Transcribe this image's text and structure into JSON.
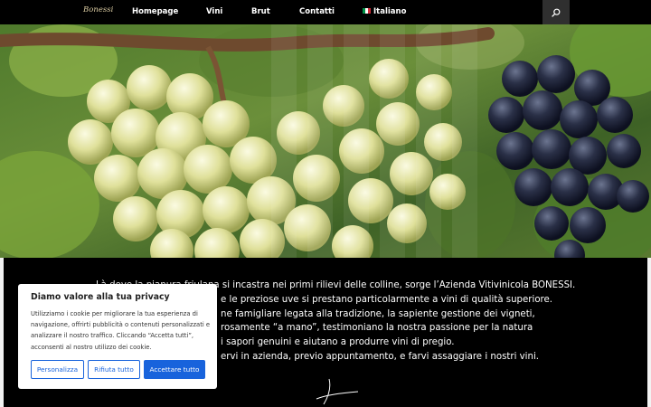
{
  "header": {
    "logo_text": "Bonessi",
    "menu": [
      "Homepage",
      "Vini",
      "Brut",
      "Contatti"
    ],
    "language": "Italiano",
    "search_icon": "search-icon"
  },
  "hero": {
    "image": "vineyard-grapes-photo"
  },
  "content": {
    "paragraph_lines": [
      "Là dove la pianura friulana si incastra nei primi rilievi delle colline, sorge l’Azienda Vitivinicola BONESSI.",
      "e le preziose uve si prestano particolarmente a vini di qualità superiore.",
      "ne famigliare legata alla tradizione, la sapiente gestione dei vigneti,",
      "rosamente “a mano”, testimoniano la nostra passione per la natura",
      "i sapori genuini e aiutano a produrre vini di pregio.",
      "ervi in azienda, previo appuntamento, e farvi assaggiare i nostri vini."
    ]
  },
  "cookie_banner": {
    "title": "Diamo valore alla tua privacy",
    "body": "Utilizziamo i cookie per migliorare la tua esperienza di navigazione, offrirti pubblicità o contenuti personalizzati e analizzare il nostro traffico. Cliccando “Accetta tutti”, acconsenti al nostro utilizzo dei cookie.",
    "customize_label": "Personalizza",
    "reject_label": "Rifiuta tutto",
    "accept_label": "Accettare tutto"
  },
  "colors": {
    "header_bg": "#000000",
    "search_bg": "#2f2f2f",
    "accent": "#1863dc",
    "content_bg": "#000000"
  }
}
